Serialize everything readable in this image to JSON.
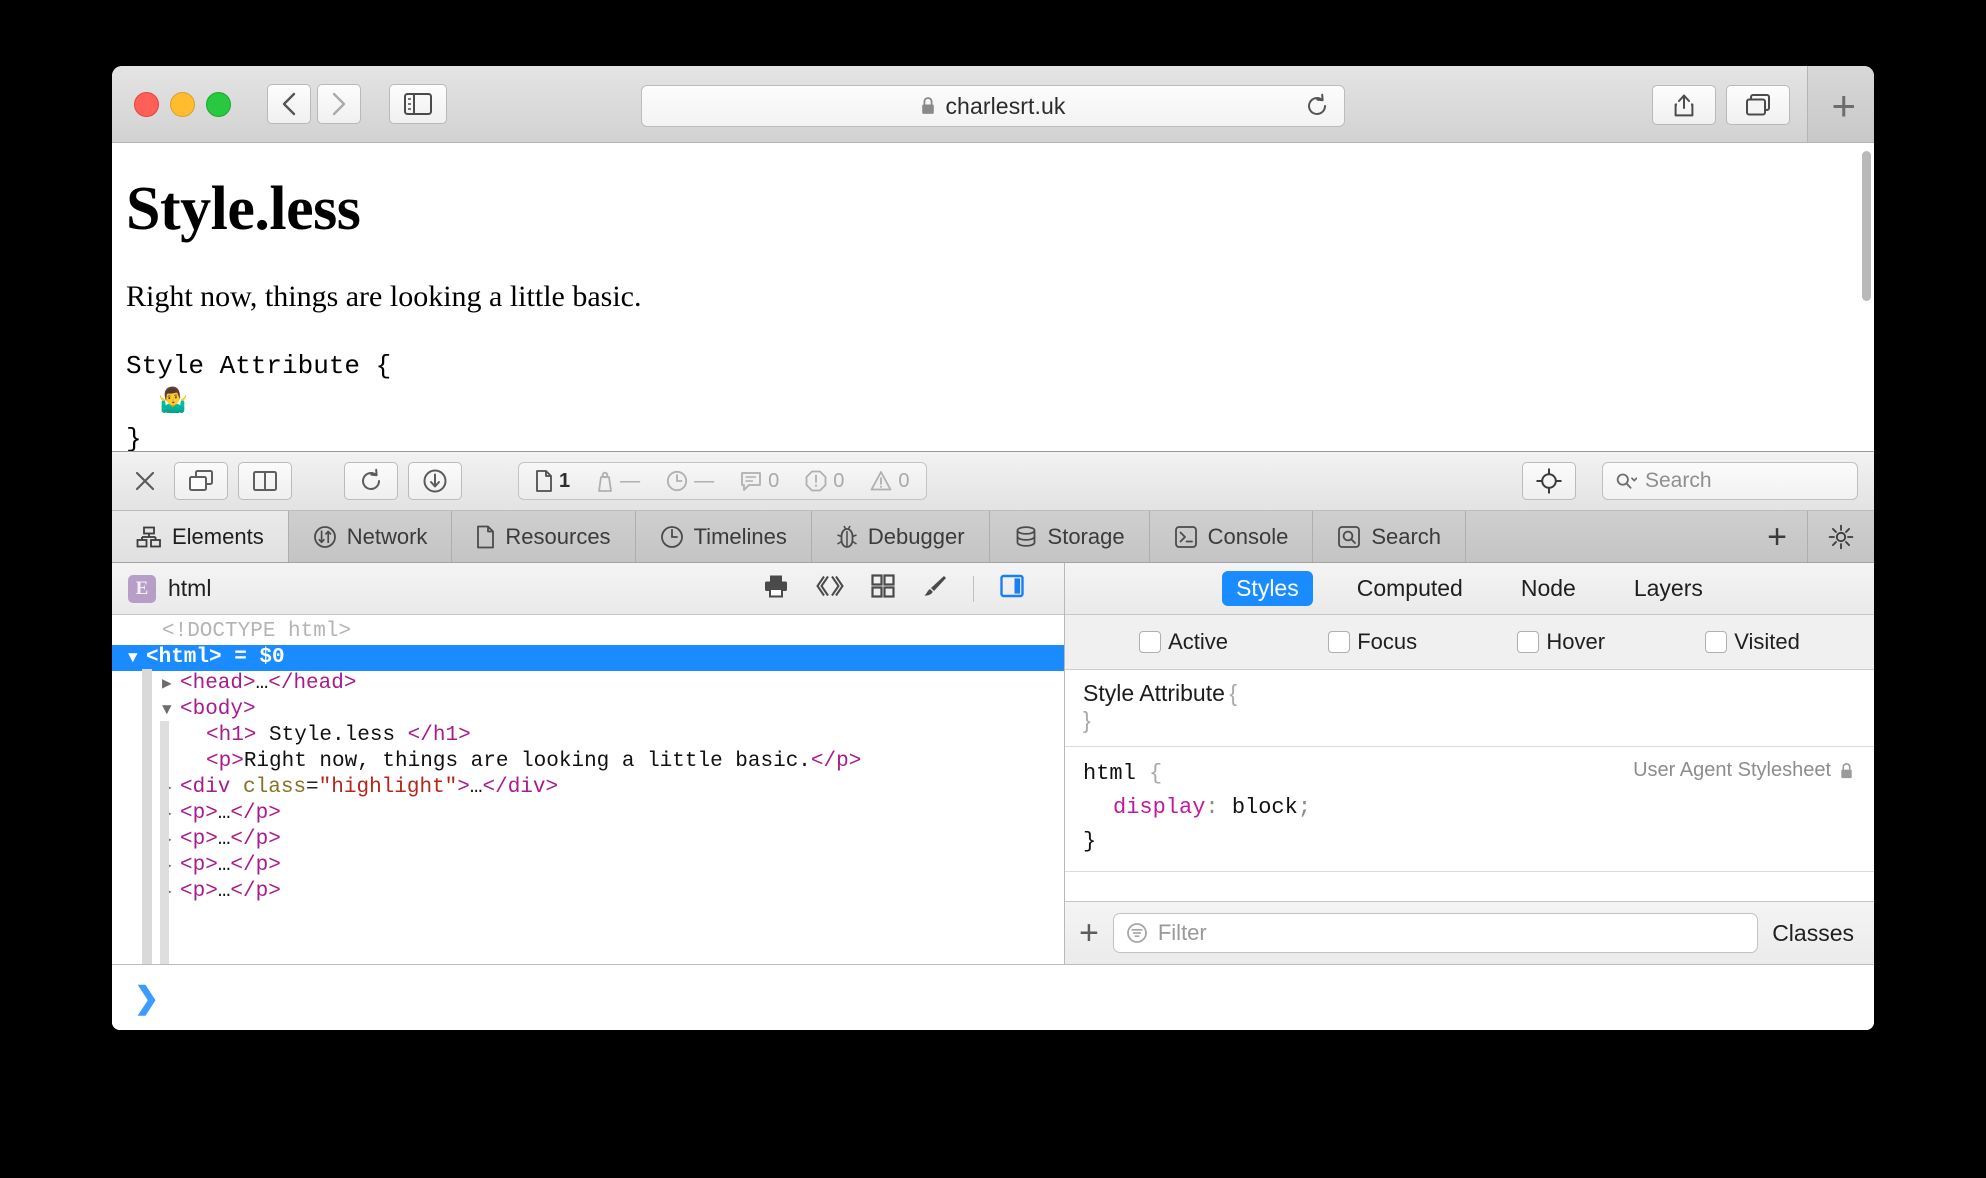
{
  "window": {
    "traffic_lights": [
      "close",
      "minimize",
      "zoom"
    ],
    "url": "charlesrt.uk",
    "lock_icon": "lock-icon",
    "reload_icon": "reload-icon",
    "back_icon": "chevron-left-icon",
    "forward_icon": "chevron-right-icon",
    "sidebar_icon": "sidebar-icon",
    "share_icon": "share-icon",
    "tabs_icon": "tab-overview-icon",
    "new_tab_label": "+"
  },
  "webpage": {
    "heading": "Style.less",
    "paragraph": "Right now, things are looking a little basic.",
    "code_line1": "Style Attribute {",
    "code_emoji": "🤷‍♂️",
    "code_line3": "}"
  },
  "devtools": {
    "toolbar": {
      "close_icon": "close-icon",
      "dock_icon": "dock-window-icon",
      "split_icon": "split-pane-icon",
      "reload_icon": "reload-icon",
      "download_icon": "download-icon",
      "inspect_icon": "crosshair-inspect-icon",
      "search_placeholder": "Search",
      "search_icon": "search-icon",
      "stats": [
        {
          "icon": "document-icon",
          "value": "1",
          "muted": false
        },
        {
          "icon": "weight-icon",
          "value": "—",
          "muted": true
        },
        {
          "icon": "clock-icon",
          "value": "—",
          "muted": true
        },
        {
          "icon": "message-icon",
          "value": "0",
          "muted": true
        },
        {
          "icon": "error-icon",
          "value": "0",
          "muted": true
        },
        {
          "icon": "warning-icon",
          "value": "0",
          "muted": true
        }
      ]
    },
    "tabs": [
      {
        "label": "Elements",
        "icon": "elements-icon",
        "active": true
      },
      {
        "label": "Network",
        "icon": "network-icon",
        "active": false
      },
      {
        "label": "Resources",
        "icon": "resources-icon",
        "active": false
      },
      {
        "label": "Timelines",
        "icon": "timelines-icon",
        "active": false
      },
      {
        "label": "Debugger",
        "icon": "debugger-bug-icon",
        "active": false
      },
      {
        "label": "Storage",
        "icon": "storage-database-icon",
        "active": false
      },
      {
        "label": "Console",
        "icon": "console-prompt-icon",
        "active": false
      },
      {
        "label": "Search",
        "icon": "search-icon",
        "active": false
      }
    ],
    "tab_add_label": "+",
    "tab_settings_icon": "gear-icon",
    "breadcrumb": {
      "badge": "E",
      "label": "html",
      "icons": [
        "print-icon",
        "code-brackets-icon",
        "grid-layout-icon",
        "paintbrush-icon",
        "toggle-panel-icon"
      ]
    },
    "dom": [
      {
        "indent": 1,
        "triangle": "none",
        "type": "doctype",
        "text": "<!DOCTYPE html>"
      },
      {
        "indent": 0,
        "triangle": "down",
        "type": "selected",
        "tag": "<html>",
        "suffix": " = $0"
      },
      {
        "indent": 1,
        "triangle": "right",
        "type": "tag",
        "tag": "<head>",
        "ellipsis": "…",
        "close": "</head>"
      },
      {
        "indent": 1,
        "triangle": "down",
        "type": "tag",
        "tag": "<body>"
      },
      {
        "indent": 2,
        "triangle": "none",
        "type": "text-node",
        "tag": "<h1>",
        "text": " Style.less ",
        "close": "</h1>"
      },
      {
        "indent": 2,
        "triangle": "none",
        "type": "text-node",
        "tag": "<p>",
        "text": "Right now, things are looking a little basic.",
        "close": "</p>"
      },
      {
        "indent": 2,
        "triangle": "right",
        "type": "attr",
        "tag": "<div",
        "attr_name": "class",
        "attr_value": "\"highlight\"",
        "tag_end": ">",
        "ellipsis": "…",
        "close": "</div>"
      },
      {
        "indent": 2,
        "triangle": "right",
        "type": "tag",
        "tag": "<p>",
        "ellipsis": "…",
        "close": "</p>"
      },
      {
        "indent": 2,
        "triangle": "right",
        "type": "tag",
        "tag": "<p>",
        "ellipsis": "…",
        "close": "</p>"
      },
      {
        "indent": 2,
        "triangle": "right",
        "type": "tag",
        "tag": "<p>",
        "ellipsis": "…",
        "close": "</p>"
      },
      {
        "indent": 2,
        "triangle": "right",
        "type": "tag",
        "tag": "<p>",
        "ellipsis": "…",
        "close": "</p>"
      }
    ],
    "console_prompt": "❯",
    "styles": {
      "tabs": [
        {
          "label": "Styles",
          "active": true
        },
        {
          "label": "Computed",
          "active": false
        },
        {
          "label": "Node",
          "active": false
        },
        {
          "label": "Layers",
          "active": false
        }
      ],
      "pseudo_states": [
        {
          "label": "Active",
          "checked": false
        },
        {
          "label": "Focus",
          "checked": false
        },
        {
          "label": "Hover",
          "checked": false
        },
        {
          "label": "Visited",
          "checked": false
        }
      ],
      "rules": [
        {
          "selector": "Style Attribute",
          "selector_font": "sans",
          "open_brace": "{",
          "close_brace": "}",
          "declarations": [],
          "origin": null
        },
        {
          "selector": "html",
          "selector_font": "mono",
          "open_brace": "{",
          "close_brace": "}",
          "declarations": [
            {
              "property": "display",
              "value": "block"
            }
          ],
          "origin": "User Agent Stylesheet",
          "origin_icon": "lock-icon"
        }
      ],
      "filter": {
        "add_label": "+",
        "icon": "filter-icon",
        "placeholder": "Filter",
        "classes_label": "Classes"
      }
    }
  },
  "colors": {
    "accent_blue": "#1a8cff",
    "tag_purple": "#a81b8d",
    "attr_name": "#8a7024",
    "attr_value": "#b5251a",
    "property_magenta": "#c2189e",
    "badge_purple": "#b79ec6"
  }
}
